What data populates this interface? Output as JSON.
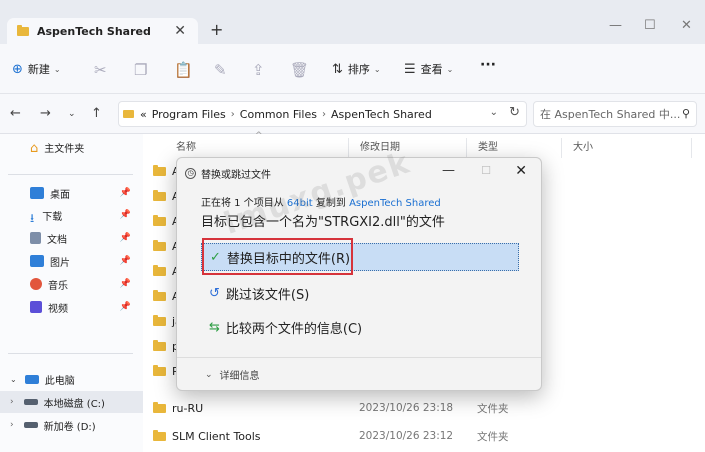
{
  "tab": {
    "title": "AspenTech Shared",
    "close": "✕",
    "new": "+"
  },
  "window": {
    "minimize": "—",
    "maximize": "☐",
    "close": "✕"
  },
  "toolbar": {
    "new_label": "新建",
    "sort_label": "排序",
    "view_label": "查看",
    "more": "···"
  },
  "address": {
    "prefix": "«",
    "crumbs": [
      "Program Files",
      "Common Files",
      "AspenTech Shared"
    ],
    "separator": "›",
    "search_placeholder": "在 AspenTech Shared 中..."
  },
  "sidebar": {
    "home": "主文件夹",
    "items": [
      {
        "label": "桌面",
        "color": "#2f7fd8"
      },
      {
        "label": "下载",
        "color": "#2f7fd8"
      },
      {
        "label": "文档",
        "color": "#7d8ea8"
      },
      {
        "label": "图片",
        "color": "#2f7fd8"
      },
      {
        "label": "音乐",
        "color": "#e2563d"
      },
      {
        "label": "视频",
        "color": "#5b4fd8"
      }
    ],
    "this_pc": "此电脑",
    "drives": [
      "本地磁盘 (C:)",
      "新加卷 (D:)"
    ]
  },
  "columns": {
    "name": "名称",
    "date": "修改日期",
    "type": "类型",
    "size": "大小"
  },
  "files": [
    {
      "name": "As",
      "date": "",
      "type": ""
    },
    {
      "name": "As",
      "date": "",
      "type": ""
    },
    {
      "name": "As",
      "date": "",
      "type": ""
    },
    {
      "name": "As",
      "date": "",
      "type": ""
    },
    {
      "name": "As",
      "date": "",
      "type": ""
    },
    {
      "name": "As",
      "date": "",
      "type": ""
    },
    {
      "name": "ja-",
      "date": "",
      "type": ""
    },
    {
      "name": "plu",
      "date": "",
      "type": ""
    },
    {
      "name": "PS",
      "date": "",
      "type": ""
    },
    {
      "name": "ru-RU",
      "date": "2023/10/26 23:18",
      "type": "文件夹"
    },
    {
      "name": "SLM Client Tools",
      "date": "2023/10/26 23:12",
      "type": "文件夹"
    }
  ],
  "dialog": {
    "title": "替换或跳过文件",
    "line1_pre": "正在将 1 个项目从",
    "source": "64bit",
    "line1_mid": "复制到",
    "dest": "AspenTech Shared",
    "message": "目标已包含一个名为\"STRGXI2.dll\"的文件",
    "options": [
      {
        "icon": "✓",
        "label": "替换目标中的文件(R)",
        "color": "#2e9e44"
      },
      {
        "icon": "↺",
        "label": "跳过该文件(S)",
        "color": "#2f6fd8"
      },
      {
        "icon": "⇆",
        "label": "比较两个文件的信息(C)",
        "color": "#2e9e44"
      }
    ],
    "details": "详细信息"
  },
  "watermark": "lmuxg.pek"
}
